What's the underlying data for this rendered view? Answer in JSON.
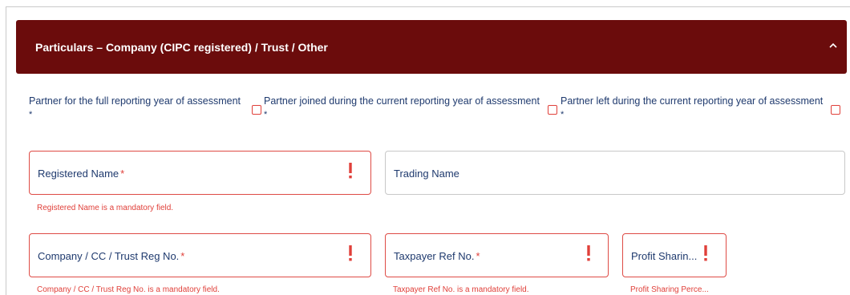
{
  "panel": {
    "title": "Particulars – Company (CIPC registered) / Trust / Other",
    "collapse_icon": "chevron-up-icon"
  },
  "partner_options": [
    {
      "label": "Partner for the full reporting year of assessment",
      "required_mark": "*",
      "checked": false
    },
    {
      "label": "Partner joined during the current reporting year of assessment",
      "required_mark": "*",
      "checked": false
    },
    {
      "label": "Partner left during the current reporting year of assessment",
      "required_mark": "*",
      "checked": false
    }
  ],
  "fields": {
    "registered_name": {
      "label": "Registered Name",
      "required_mark": "*",
      "error": "Registered Name is a mandatory field.",
      "error_icon": "exclamation-icon"
    },
    "trading_name": {
      "label": "Trading Name"
    },
    "reg_no": {
      "label": "Company / CC / Trust Reg No.",
      "required_mark": "*",
      "error": "Company / CC / Trust Reg No. is a mandatory field.",
      "error_icon": "exclamation-icon"
    },
    "taxpayer_ref": {
      "label": "Taxpayer Ref No.",
      "required_mark": "*",
      "error": "Taxpayer Ref No. is a mandatory field.",
      "error_icon": "exclamation-icon"
    },
    "profit_sharing": {
      "label": "Profit Sharin...",
      "error": "Profit Sharing Perce...",
      "error_icon": "exclamation-icon"
    }
  },
  "colors": {
    "header_bg": "#6b0c0c",
    "error": "#e0403a",
    "label": "#1f3a6e"
  }
}
